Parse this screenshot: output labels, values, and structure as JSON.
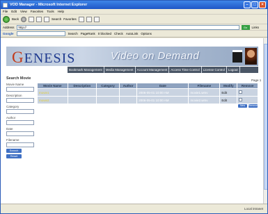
{
  "window": {
    "title": "VOD Manager - Microsoft Internet Explorer"
  },
  "menubar": [
    "File",
    "Edit",
    "View",
    "Favorites",
    "Tools",
    "Help"
  ],
  "toolbar": {
    "back_label": "Back",
    "search_label": "Search",
    "favorites_label": "Favorites"
  },
  "address": {
    "label": "Address",
    "value": "http://",
    "go_label": "Go",
    "links_label": "Links"
  },
  "googlebar": {
    "logo": "Google",
    "search_label": "Search",
    "pagerank_label": "PageRank",
    "popups_label": "0 blocked",
    "check_label": "Check",
    "autolink_label": "AutoLink",
    "options_label": "Options"
  },
  "banner": {
    "logo_first": "G",
    "logo_rest": "ENESIS",
    "tagline": "Video on Demand"
  },
  "nav": [
    "Bookmark Management",
    "Media Management",
    "Account Management",
    "Access Time Control",
    "License Control",
    "Logout"
  ],
  "search_panel": {
    "title": "Search Movie",
    "fields": [
      "Movie Name",
      "Description",
      "Category",
      "Author",
      "Date",
      "Filename"
    ],
    "search_button": "Search",
    "reset_button": "Reset"
  },
  "page_indicator": "Page 1",
  "table": {
    "headers": [
      "Movie Name",
      "Description",
      "Category",
      "Author",
      "Date",
      "Filename",
      "Modify",
      "Remove"
    ],
    "rows": [
      {
        "movie": "movie1",
        "date": "2006-05-01 10:00 AM",
        "filename": "movie1.wmv",
        "modify": "Edit"
      },
      {
        "movie": "movie2",
        "date": "2006-05-01 10:00 AM",
        "filename": "movie2.wmv",
        "modify": "Edit"
      }
    ]
  },
  "table_buttons": {
    "add": "New",
    "remove": "Remove"
  },
  "statusbar": {
    "zone": "Local intranet"
  }
}
